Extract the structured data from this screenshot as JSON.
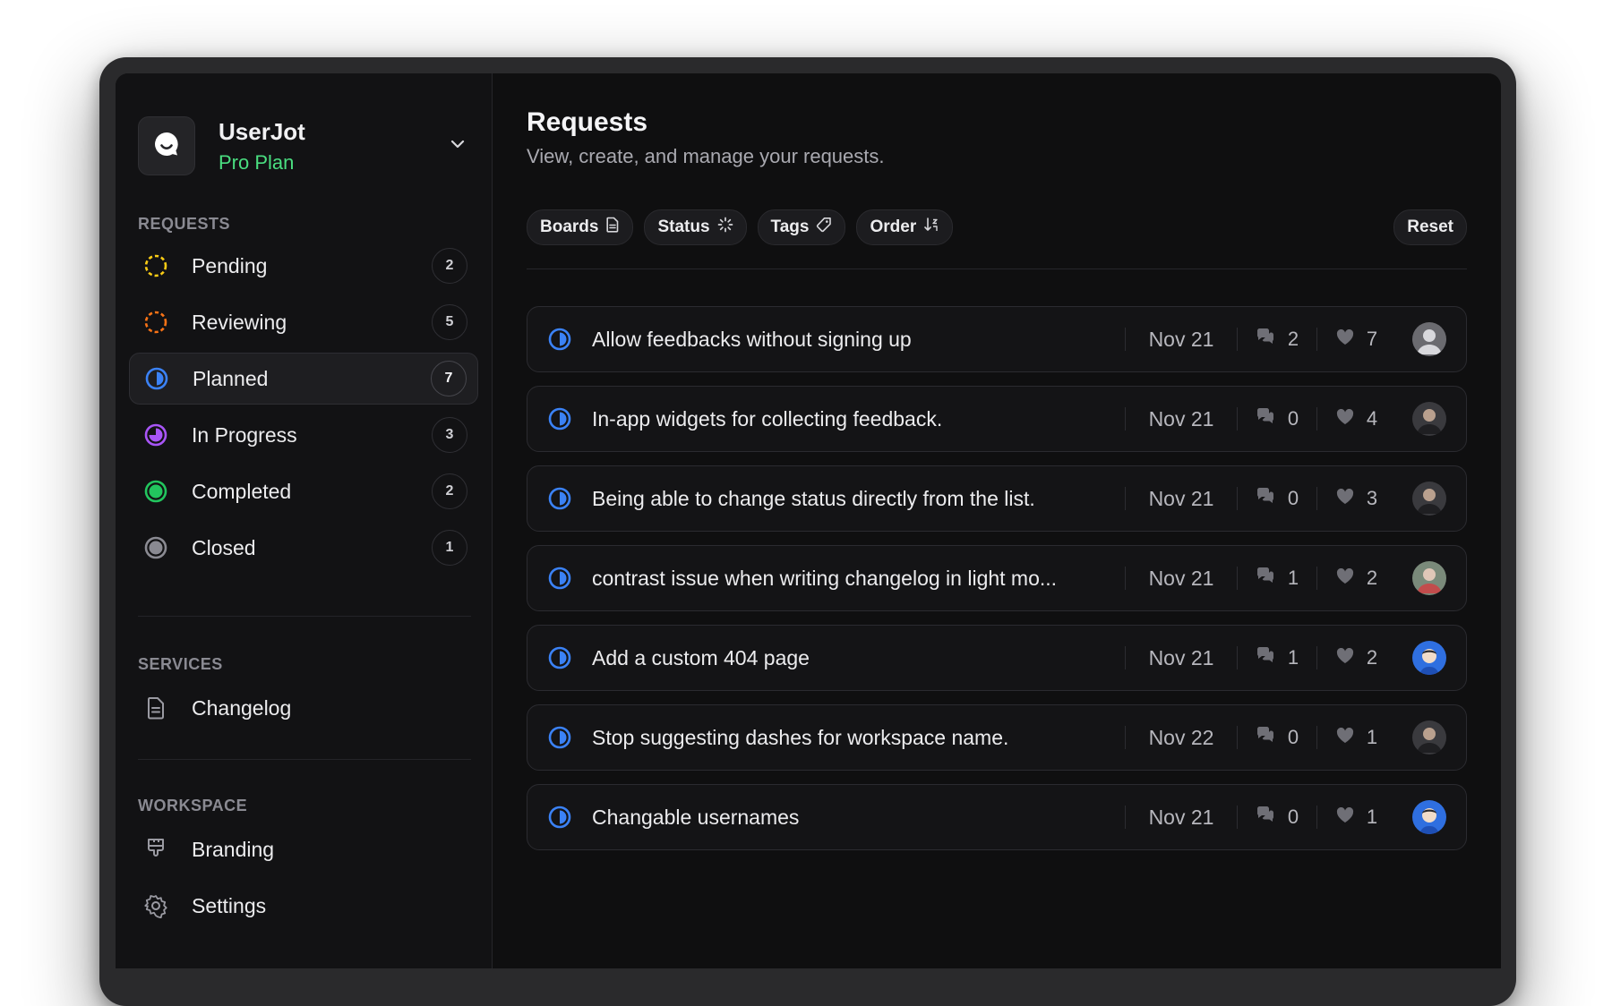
{
  "workspace": {
    "name": "UserJot",
    "plan": "Pro Plan",
    "logo_icon": "chat-bubble-smile-icon"
  },
  "sidebar": {
    "requests_heading": "REQUESTS",
    "statuses": [
      {
        "label": "Pending",
        "count": "2",
        "icon": "pending-dashed-circle-icon",
        "color": "#facc15"
      },
      {
        "label": "Reviewing",
        "count": "5",
        "icon": "reviewing-dashed-circle-icon",
        "color": "#f97316"
      },
      {
        "label": "Planned",
        "count": "7",
        "icon": "planned-half-circle-icon",
        "color": "#3b82f6",
        "active": true
      },
      {
        "label": "In Progress",
        "count": "3",
        "icon": "in-progress-circle-icon",
        "color": "#a855f7"
      },
      {
        "label": "Completed",
        "count": "2",
        "icon": "completed-circle-icon",
        "color": "#22c55e"
      },
      {
        "label": "Closed",
        "count": "1",
        "icon": "closed-circle-icon",
        "color": "#8a8a92"
      }
    ],
    "services_heading": "SERVICES",
    "services": [
      {
        "label": "Changelog",
        "icon": "document-icon"
      }
    ],
    "workspace_heading": "WORKSPACE",
    "workspace_items": [
      {
        "label": "Branding",
        "icon": "paintbrush-icon"
      },
      {
        "label": "Settings",
        "icon": "gear-icon"
      }
    ]
  },
  "main": {
    "title": "Requests",
    "subtitle": "View, create, and manage your requests.",
    "filters": [
      {
        "label": "Boards",
        "icon": "document-icon"
      },
      {
        "label": "Status",
        "icon": "loader-icon"
      },
      {
        "label": "Tags",
        "icon": "tag-icon"
      },
      {
        "label": "Order",
        "icon": "sort-icon"
      }
    ],
    "reset_label": "Reset",
    "requests": [
      {
        "title": "Allow feedbacks without signing up",
        "date": "Nov 21",
        "comments": "2",
        "votes": "7",
        "avatar_color": "#6b6b70"
      },
      {
        "title": "In-app widgets for collecting feedback.",
        "date": "Nov 21",
        "comments": "0",
        "votes": "4",
        "avatar_color": "#3a3a3e"
      },
      {
        "title": "Being able to change status directly from the list.",
        "date": "Nov 21",
        "comments": "0",
        "votes": "3",
        "avatar_color": "#3a3a3e"
      },
      {
        "title": "contrast issue when writing changelog in light mo...",
        "date": "Nov 21",
        "comments": "1",
        "votes": "2",
        "avatar_color": "#7a8a7a"
      },
      {
        "title": "Add a custom 404 page",
        "date": "Nov 21",
        "comments": "1",
        "votes": "2",
        "avatar_color": "#2f6fe0"
      },
      {
        "title": "Stop suggesting dashes for workspace name.",
        "date": "Nov 22",
        "comments": "0",
        "votes": "1",
        "avatar_color": "#3a3a3e"
      },
      {
        "title": "Changable usernames",
        "date": "Nov 21",
        "comments": "0",
        "votes": "1",
        "avatar_color": "#2f6fe0"
      }
    ]
  }
}
